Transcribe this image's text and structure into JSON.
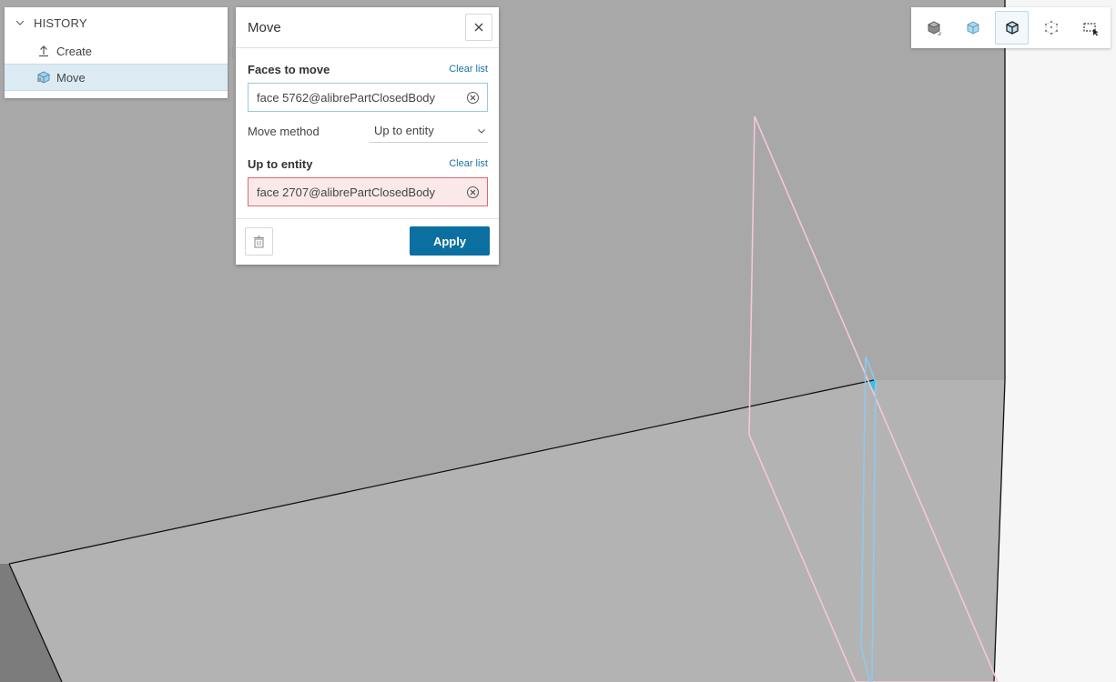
{
  "history": {
    "title": "HISTORY",
    "items": [
      {
        "label": "Create",
        "icon": "upload-arrow-icon",
        "selected": false
      },
      {
        "label": "Move",
        "icon": "cube-move-icon",
        "selected": true
      }
    ]
  },
  "move_dialog": {
    "title": "Move",
    "faces_to_move": {
      "label": "Faces to move",
      "clear_label": "Clear list",
      "value": "face 5762@alibrePartClosedBody"
    },
    "move_method": {
      "label": "Move method",
      "value": "Up to entity"
    },
    "up_to_entity": {
      "label": "Up to entity",
      "clear_label": "Clear list",
      "value": "face 2707@alibrePartClosedBody"
    },
    "apply_label": "Apply"
  },
  "toolbar": {
    "buttons": [
      {
        "icon": "solid-cube-icon",
        "active": false
      },
      {
        "icon": "transparent-cube-icon",
        "active": false
      },
      {
        "icon": "wireframe-edges-cube-icon",
        "active": true
      },
      {
        "icon": "points-cube-icon",
        "active": false
      },
      {
        "icon": "box-select-icon",
        "active": false
      }
    ]
  },
  "colors": {
    "accent": "#0b6f9f",
    "link": "#1a73a8",
    "selected_row": "#dcebf3",
    "error_field": "#fbe9ea",
    "viewport_floor": "#b3b3b3",
    "viewport_wall": "#a8a8a8",
    "pink_face": "#f4c6dc",
    "blue_face": "#8ec9ee"
  }
}
